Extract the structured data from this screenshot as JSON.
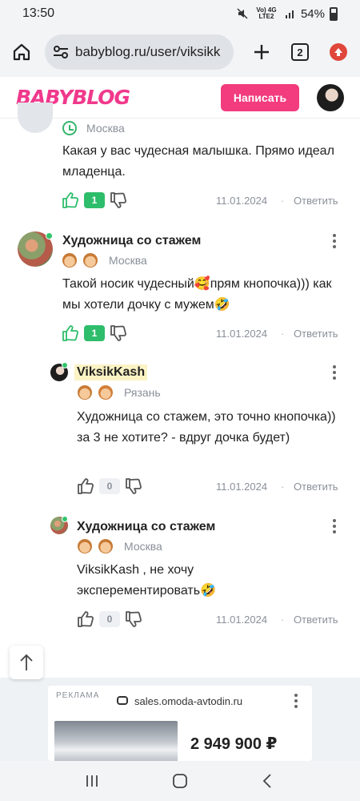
{
  "status_bar": {
    "time": "13:50",
    "network": "Vo) 4G LTE2",
    "battery": "54%"
  },
  "browser": {
    "url": "babyblog.ru/user/viksikk",
    "tab_count": "2"
  },
  "site": {
    "logo": "BABYBLOG",
    "write_button": "Написать"
  },
  "comments": [
    {
      "location": "Москва",
      "text": "Какая у вас чудесная малышка. Прямо идеал младенца.",
      "likes": "1",
      "date": "11.01.2024",
      "reply": "Ответить"
    },
    {
      "author": "Художница со стажем",
      "location": "Москва",
      "text": "Такой носик чудесный🥰прям кнопочка))) как мы хотели дочку с мужем🤣",
      "likes": "1",
      "date": "11.01.2024",
      "reply": "Ответить"
    },
    {
      "author": "ViksikKash",
      "location": "Рязань",
      "text": "Художница со стажем, это точно кнопочка)) за 3 не хотите? - вдруг дочка будет)",
      "likes": "0",
      "date": "11.01.2024",
      "reply": "Ответить"
    },
    {
      "author": "Художница со стажем",
      "location": "Москва",
      "text": "ViksikKash , не хочу эксперементировать🤣",
      "likes": "0",
      "date": "11.01.2024",
      "reply": "Ответить"
    }
  ],
  "ad": {
    "label": "РЕКЛАМА",
    "domain": "sales.omoda-avtodin.ru",
    "price": "2 949 900 ₽"
  },
  "separator": "·",
  "colors": {
    "brand_pink": "#f23c7d",
    "like_green": "#2ebd6b",
    "online_green": "#31c46b",
    "highlight": "#fbf3c4"
  },
  "icons": [
    "home-icon",
    "site-settings-icon",
    "add-tab-icon",
    "tabs-icon",
    "update-icon",
    "clock-icon",
    "thumb-up-icon",
    "thumb-down-icon",
    "more-icon",
    "arrow-up-icon",
    "recents-icon",
    "home-nav-icon",
    "back-icon"
  ]
}
